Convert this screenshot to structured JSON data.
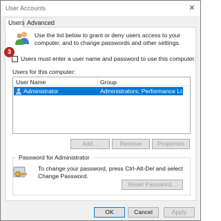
{
  "window": {
    "title": "User Accounts",
    "close_glyph": "✕"
  },
  "tabs": [
    {
      "label": "Users",
      "active": true
    },
    {
      "label": "Advanced",
      "active": false
    }
  ],
  "intro_text": "Use the list below to grant or deny users access to your computer, and to change passwords and other settings.",
  "step_badge": "3",
  "must_enter": {
    "label": "Users must enter a user name and password to use this computer.",
    "checked": false
  },
  "users_label": "Users for this computer:",
  "users_table": {
    "columns": [
      "User Name",
      "Group"
    ],
    "rows": [
      {
        "user": "Administrator",
        "group": "Administrators; Performance Log...",
        "selected": true
      }
    ]
  },
  "buttons": {
    "add": "Add...",
    "remove": "Remove",
    "properties": "Properties"
  },
  "password_group": {
    "title": "Password for Administrator",
    "text": "To change your password, press Ctrl-Alt-Del and select Change Password.",
    "reset_button": "Reset Password..."
  },
  "footer": {
    "ok": "OK",
    "cancel": "Cancel",
    "apply": "Apply"
  },
  "colors": {
    "selection": "#0078d7",
    "badge": "#b7261e"
  },
  "icons": [
    "users-icon",
    "user-icon",
    "key-icon",
    "close-icon"
  ]
}
